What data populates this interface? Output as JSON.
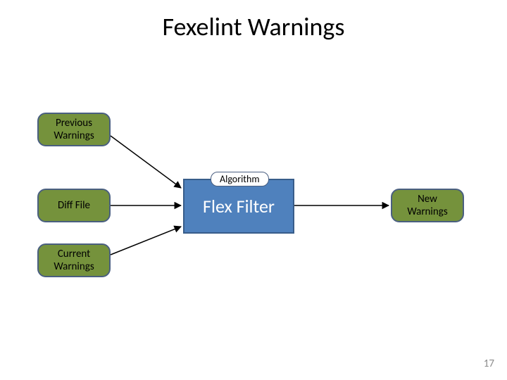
{
  "title": "Fexelint Warnings",
  "nodes": {
    "previous": "Previous\nWarnings",
    "diff": "Diff File",
    "current": "Current\nWarnings",
    "new": "New\nWarnings"
  },
  "algorithm_label": "Algorithm",
  "filter_label": "Flex Filter",
  "page_number": "17",
  "colors": {
    "node_fill": "#75923c",
    "node_border": "#4a5f80",
    "filter_fill": "#4f81bd",
    "filter_border": "#385d8a",
    "arrow": "#000000"
  }
}
